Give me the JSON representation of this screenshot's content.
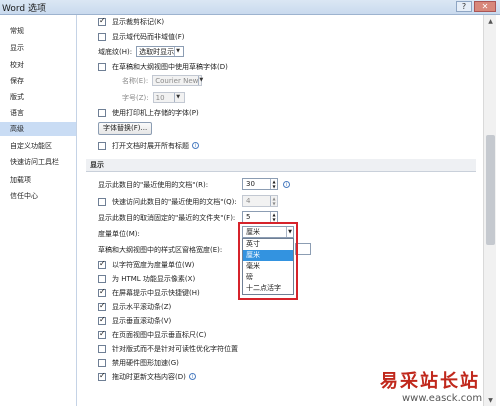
{
  "window": {
    "title": "Word 选项",
    "help": "?",
    "close": "✕"
  },
  "sidebar": {
    "items": [
      {
        "label": "常规"
      },
      {
        "label": "显示"
      },
      {
        "label": "校对"
      },
      {
        "label": "保存"
      },
      {
        "label": "版式"
      },
      {
        "label": "语言"
      },
      {
        "label": "高级"
      },
      {
        "label": "自定义功能区"
      },
      {
        "label": "快速访问工具栏"
      },
      {
        "label": "加载项"
      },
      {
        "label": "信任中心"
      }
    ],
    "active": "高级"
  },
  "content": {
    "show_bookmarks": "显示裁剪标记(K)",
    "show_field_codes": "显示域代码而非域值(F)",
    "field_shading_label": "域底纹(H):",
    "field_shading_value": "选取时显示",
    "draft_font": "在草稿和大纲视图中使用草稿字体(D)",
    "font_name_label": "名称(E):",
    "font_name_value": "Courier New",
    "font_size_label": "字号(Z):",
    "font_size_value": "10",
    "printer_fonts": "使用打印机上存储的字体(P)",
    "font_substitution": "字体替换(F)...",
    "open_in_draft": "打开文档时展开所有标题",
    "display_section": "显示",
    "recent_docs_label": "显示此数目的\"最近使用的文档\"(R):",
    "recent_docs_value": "30",
    "quick_access_label": "快速访问此数目的\"最近使用的文档\"(Q):",
    "quick_access_value": "4",
    "unpinned_folders_label": "显示此数目的取消固定的\"最近的文件夹\"(F):",
    "unpinned_folders_value": "5",
    "units_label": "度量单位(M):",
    "units_value": "厘米",
    "style_width_label": "草稿和大纲视图中的样式区窗格宽度(E):",
    "units_options": [
      {
        "label": "英寸"
      },
      {
        "label": "厘米"
      },
      {
        "label": "毫米"
      },
      {
        "label": "磅"
      },
      {
        "label": "十二点活字"
      }
    ],
    "options": [
      {
        "label": "以字符宽度为度量单位(W)",
        "checked": true
      },
      {
        "label": "为 HTML 功能显示像素(X)",
        "checked": false
      },
      {
        "label": "在屏幕提示中显示快捷键(H)",
        "checked": true
      },
      {
        "label": "显示水平滚动条(Z)",
        "checked": true
      },
      {
        "label": "显示垂直滚动条(V)",
        "checked": true
      },
      {
        "label": "在页面视图中显示垂直标尺(C)",
        "checked": true
      },
      {
        "label": "针对版式而不是针对可读性优化字符位置",
        "checked": false
      },
      {
        "label": "禁用硬件图形加速(G)",
        "checked": false
      },
      {
        "label": "拖动时更新文档内容(D)",
        "checked": true
      }
    ]
  },
  "watermark": {
    "text": "易采站长站",
    "url": "www.easck.com"
  },
  "colors": {
    "highlight": "#3393e0",
    "red_box": "#d6232b",
    "active_nav": "#c9dcf4"
  }
}
